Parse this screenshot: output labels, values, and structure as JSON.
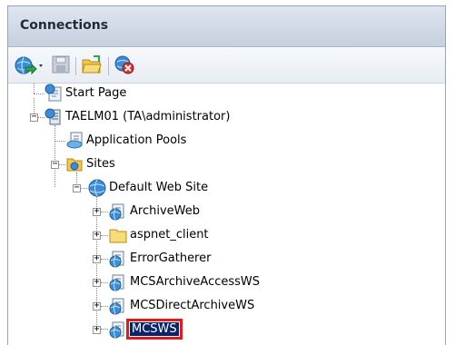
{
  "panel": {
    "title": "Connections"
  },
  "toolbar": {
    "buttons": [
      {
        "icon": "globe-connect-icon",
        "has_dropdown": true
      },
      {
        "icon": "save-icon"
      },
      {
        "icon": "open-folder-icon"
      },
      {
        "icon": "disconnect-icon"
      }
    ]
  },
  "tree": {
    "nodes": [
      {
        "label": "Start Page",
        "icon": "start-page-icon"
      },
      {
        "label": "TAELM01 (TA\\administrator)",
        "icon": "server-icon",
        "expanded": true
      },
      {
        "label": "Application Pools",
        "icon": "app-pools-icon"
      },
      {
        "label": "Sites",
        "icon": "sites-folder-icon",
        "expanded": true
      },
      {
        "label": "Default Web Site",
        "icon": "globe-icon",
        "expanded": true
      },
      {
        "label": "ArchiveWeb",
        "icon": "web-app-icon",
        "expandable": true
      },
      {
        "label": "aspnet_client",
        "icon": "folder-icon",
        "expandable": true
      },
      {
        "label": "ErrorGatherer",
        "icon": "web-app-icon",
        "expandable": true
      },
      {
        "label": "MCSArchiveAccessWS",
        "icon": "web-app-icon",
        "expandable": true
      },
      {
        "label": "MCSDirectArchiveWS",
        "icon": "web-app-icon",
        "expandable": true
      },
      {
        "label": "MCSWS",
        "icon": "web-app-icon",
        "expandable": true,
        "selected": true
      }
    ]
  },
  "colors": {
    "selection": "#0a246a",
    "highlight_box": "#e21a1a"
  }
}
